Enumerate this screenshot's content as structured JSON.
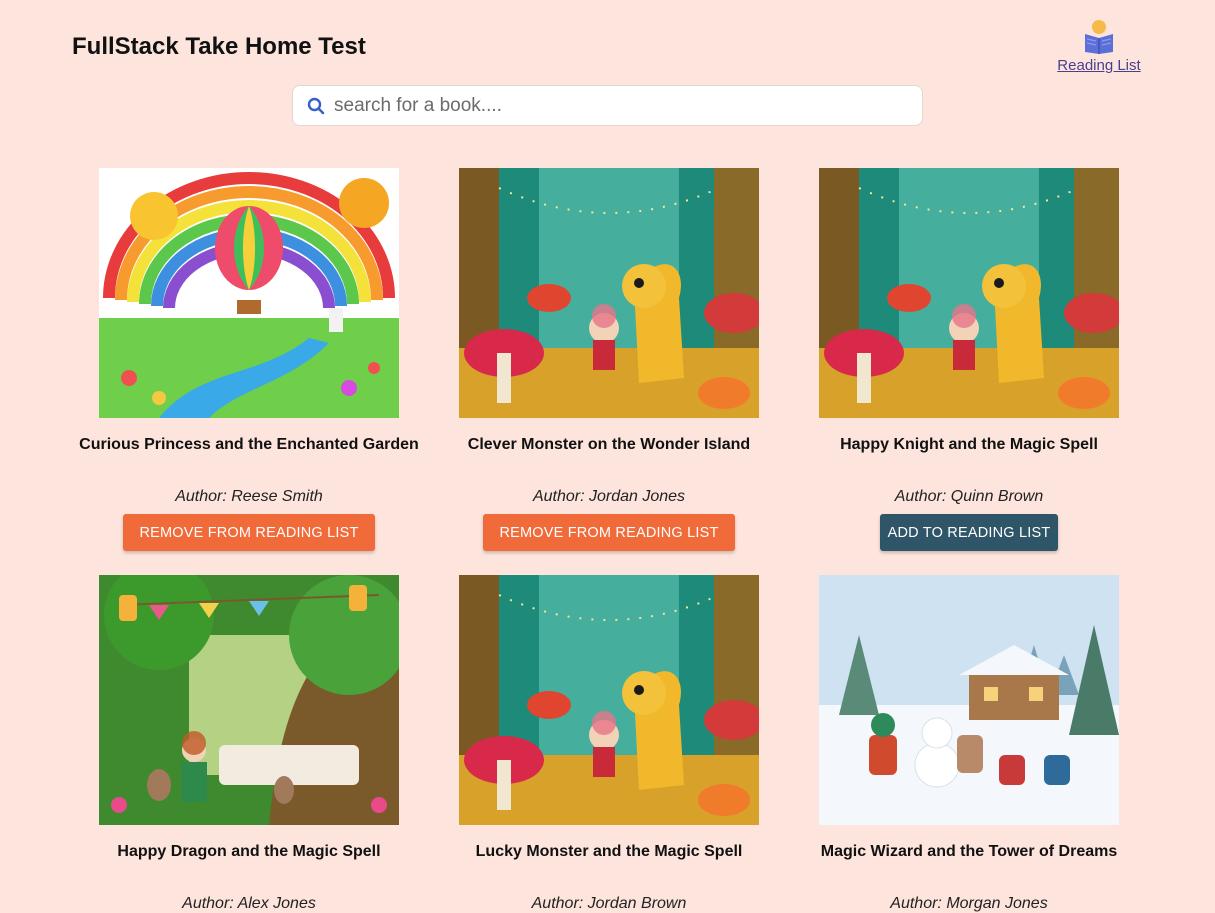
{
  "header": {
    "title": "FullStack Take Home Test",
    "reading_list_label": "Reading List"
  },
  "search": {
    "placeholder": "search for a book....",
    "value": ""
  },
  "colors": {
    "background": "#fde4dc",
    "remove_button": "#f06a3a",
    "add_button": "#2f5568",
    "link": "#4a3f8f"
  },
  "books": [
    {
      "title": "Curious Princess and the Enchanted Garden",
      "author": "Author: Reese Smith",
      "action": "REMOVE FROM READING LIST",
      "in_list": true,
      "cover": "rainbow-balloon"
    },
    {
      "title": "Clever Monster on the Wonder Island",
      "author": "Author: Jordan Jones",
      "action": "REMOVE FROM READING LIST",
      "in_list": true,
      "cover": "forest-dragon"
    },
    {
      "title": "Happy Knight and the Magic Spell",
      "author": "Author: Quinn Brown",
      "action": "ADD TO READING LIST",
      "in_list": false,
      "cover": "forest-dragon"
    },
    {
      "title": "Happy Dragon and the Magic Spell",
      "author": "Author: Alex Jones",
      "action": "",
      "in_list": null,
      "cover": "tea-party-tree"
    },
    {
      "title": "Lucky Monster and the Magic Spell",
      "author": "Author: Jordan Brown",
      "action": "",
      "in_list": null,
      "cover": "forest-dragon"
    },
    {
      "title": "Magic Wizard and the Tower of Dreams",
      "author": "Author: Morgan Jones",
      "action": "",
      "in_list": null,
      "cover": "snowy-cabin"
    }
  ]
}
